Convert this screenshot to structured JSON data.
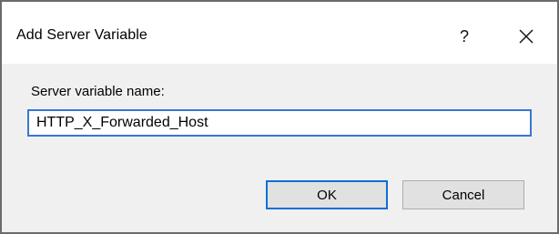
{
  "window": {
    "title": "Add Server Variable",
    "help_glyph": "?",
    "close_icon": "close-icon"
  },
  "form": {
    "label": "Server variable name:",
    "value": "HTTP_X_Forwarded_Host"
  },
  "buttons": {
    "ok_label": "OK",
    "cancel_label": "Cancel"
  },
  "colors": {
    "focus_accent": "#0f6fd6",
    "dialog_bg": "#f0f0f0",
    "titlebar_bg": "#ffffff"
  }
}
